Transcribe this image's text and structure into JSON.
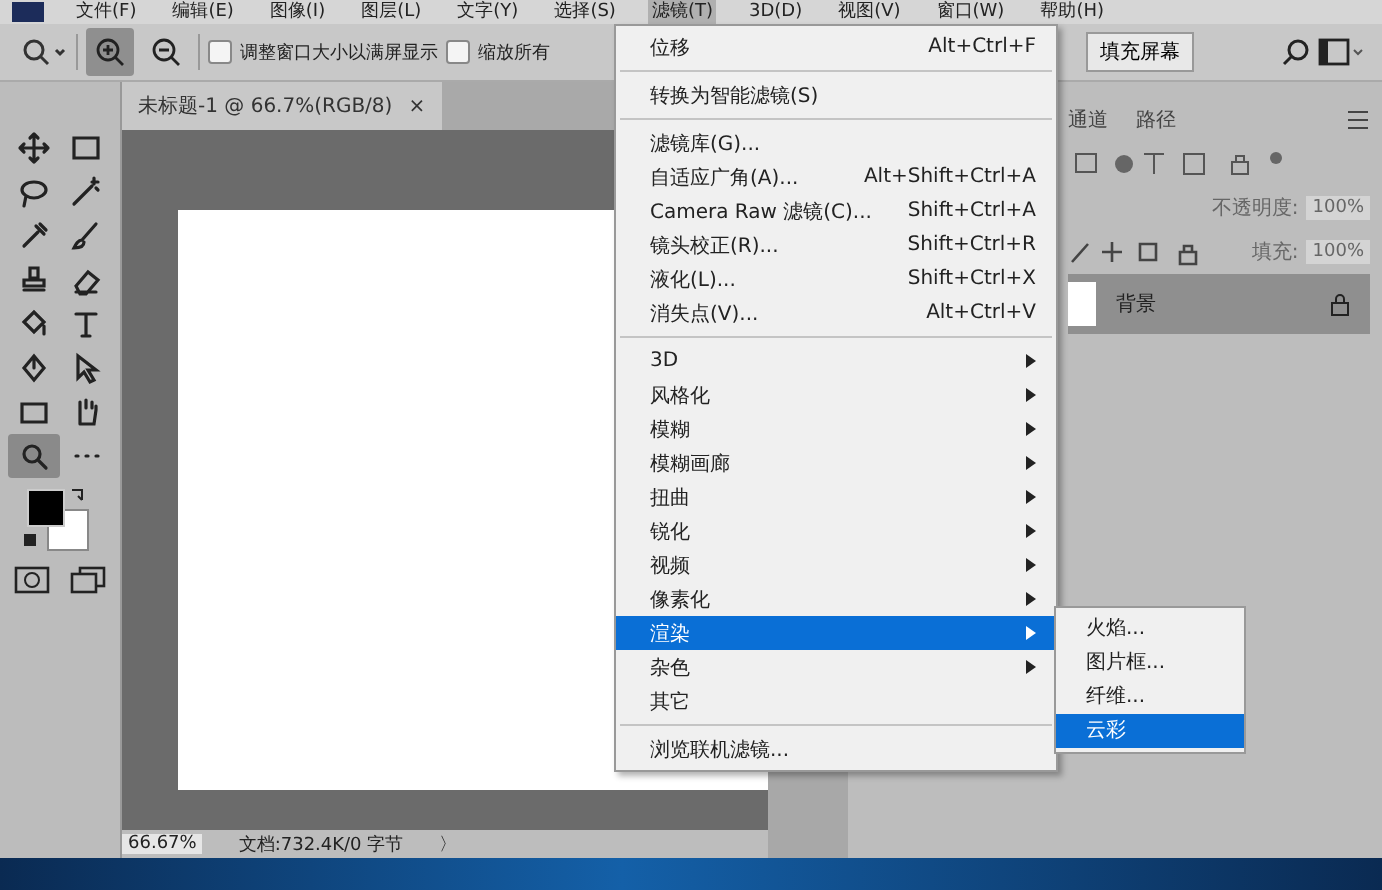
{
  "menu_bar": [
    {
      "label": "文件(F)",
      "selected": false
    },
    {
      "label": "编辑(E)",
      "selected": false
    },
    {
      "label": "图像(I)",
      "selected": false
    },
    {
      "label": "图层(L)",
      "selected": false
    },
    {
      "label": "文字(Y)",
      "selected": false
    },
    {
      "label": "选择(S)",
      "selected": false
    },
    {
      "label": "滤镜(T)",
      "selected": true
    },
    {
      "label": "3D(D)",
      "selected": false
    },
    {
      "label": "视图(V)",
      "selected": false
    },
    {
      "label": "窗口(W)",
      "selected": false
    },
    {
      "label": "帮助(H)",
      "selected": false
    }
  ],
  "options_bar": {
    "zoom_in_selected": true,
    "checkboxes": [
      {
        "label": "调整窗口大小以满屏显示",
        "checked": false
      },
      {
        "label": "缩放所有",
        "checked": false
      }
    ],
    "fill_screen_button": "填充屏幕"
  },
  "tools": [
    {
      "kind": "move",
      "selected": false
    },
    {
      "kind": "marquee",
      "selected": false
    },
    {
      "kind": "lasso",
      "selected": false
    },
    {
      "kind": "wand",
      "selected": false
    },
    {
      "kind": "eyedropper",
      "selected": false
    },
    {
      "kind": "brush",
      "selected": false
    },
    {
      "kind": "stamp",
      "selected": false
    },
    {
      "kind": "eraser",
      "selected": false
    },
    {
      "kind": "bucket",
      "selected": false
    },
    {
      "kind": "type",
      "selected": false
    },
    {
      "kind": "pen",
      "selected": false
    },
    {
      "kind": "arrow",
      "selected": false
    },
    {
      "kind": "rectangle",
      "selected": false
    },
    {
      "kind": "hand",
      "selected": false
    },
    {
      "kind": "zoom",
      "selected": true
    },
    {
      "kind": "more",
      "selected": false
    }
  ],
  "document_tab": {
    "title": "未标题-1 @ 66.7%(RGB/8)",
    "close": "×"
  },
  "status_bar": {
    "zoom": "66.67%",
    "doc_info": "文档:732.4K/0 字节",
    "arrow": "〉"
  },
  "panels": {
    "tabs": [
      {
        "label": "通道"
      },
      {
        "label": "路径"
      }
    ],
    "opacity_label": "不透明度:",
    "opacity_value": "100%",
    "fill_label": "填充:",
    "fill_value": "100%",
    "layer": {
      "name": "背景",
      "locked": true
    }
  },
  "filter_menu": [
    {
      "kind": "item",
      "label": "位移",
      "shortcut": "Alt+Ctrl+F",
      "submenu": false,
      "selected": false
    },
    {
      "kind": "separator"
    },
    {
      "kind": "item",
      "label": "转换为智能滤镜(S)",
      "submenu": false,
      "selected": false
    },
    {
      "kind": "separator"
    },
    {
      "kind": "item",
      "label": "滤镜库(G)...",
      "submenu": false,
      "selected": false
    },
    {
      "kind": "item",
      "label": "自适应广角(A)...",
      "shortcut": "Alt+Shift+Ctrl+A",
      "submenu": false,
      "selected": false
    },
    {
      "kind": "item",
      "label": "Camera Raw 滤镜(C)...",
      "shortcut": "Shift+Ctrl+A",
      "submenu": false,
      "selected": false
    },
    {
      "kind": "item",
      "label": "镜头校正(R)...",
      "shortcut": "Shift+Ctrl+R",
      "submenu": false,
      "selected": false
    },
    {
      "kind": "item",
      "label": "液化(L)...",
      "shortcut": "Shift+Ctrl+X",
      "submenu": false,
      "selected": false
    },
    {
      "kind": "item",
      "label": "消失点(V)...",
      "shortcut": "Alt+Ctrl+V",
      "submenu": false,
      "selected": false
    },
    {
      "kind": "separator"
    },
    {
      "kind": "item",
      "label": "3D",
      "submenu": true,
      "selected": false
    },
    {
      "kind": "item",
      "label": "风格化",
      "submenu": true,
      "selected": false
    },
    {
      "kind": "item",
      "label": "模糊",
      "submenu": true,
      "selected": false
    },
    {
      "kind": "item",
      "label": "模糊画廊",
      "submenu": true,
      "selected": false
    },
    {
      "kind": "item",
      "label": "扭曲",
      "submenu": true,
      "selected": false
    },
    {
      "kind": "item",
      "label": "锐化",
      "submenu": true,
      "selected": false
    },
    {
      "kind": "item",
      "label": "视频",
      "submenu": true,
      "selected": false
    },
    {
      "kind": "item",
      "label": "像素化",
      "submenu": true,
      "selected": false
    },
    {
      "kind": "item",
      "label": "渲染",
      "submenu": true,
      "selected": true
    },
    {
      "kind": "item",
      "label": "杂色",
      "submenu": true,
      "selected": false
    },
    {
      "kind": "item",
      "label": "其它",
      "submenu": false,
      "selected": false
    },
    {
      "kind": "separator"
    },
    {
      "kind": "item",
      "label": "浏览联机滤镜...",
      "submenu": false,
      "selected": false
    }
  ],
  "render_submenu": [
    {
      "label": "火焰...",
      "selected": false
    },
    {
      "label": "图片框...",
      "selected": false
    },
    {
      "label": "纤维...",
      "selected": false
    },
    {
      "label": "云彩",
      "selected": true
    }
  ]
}
